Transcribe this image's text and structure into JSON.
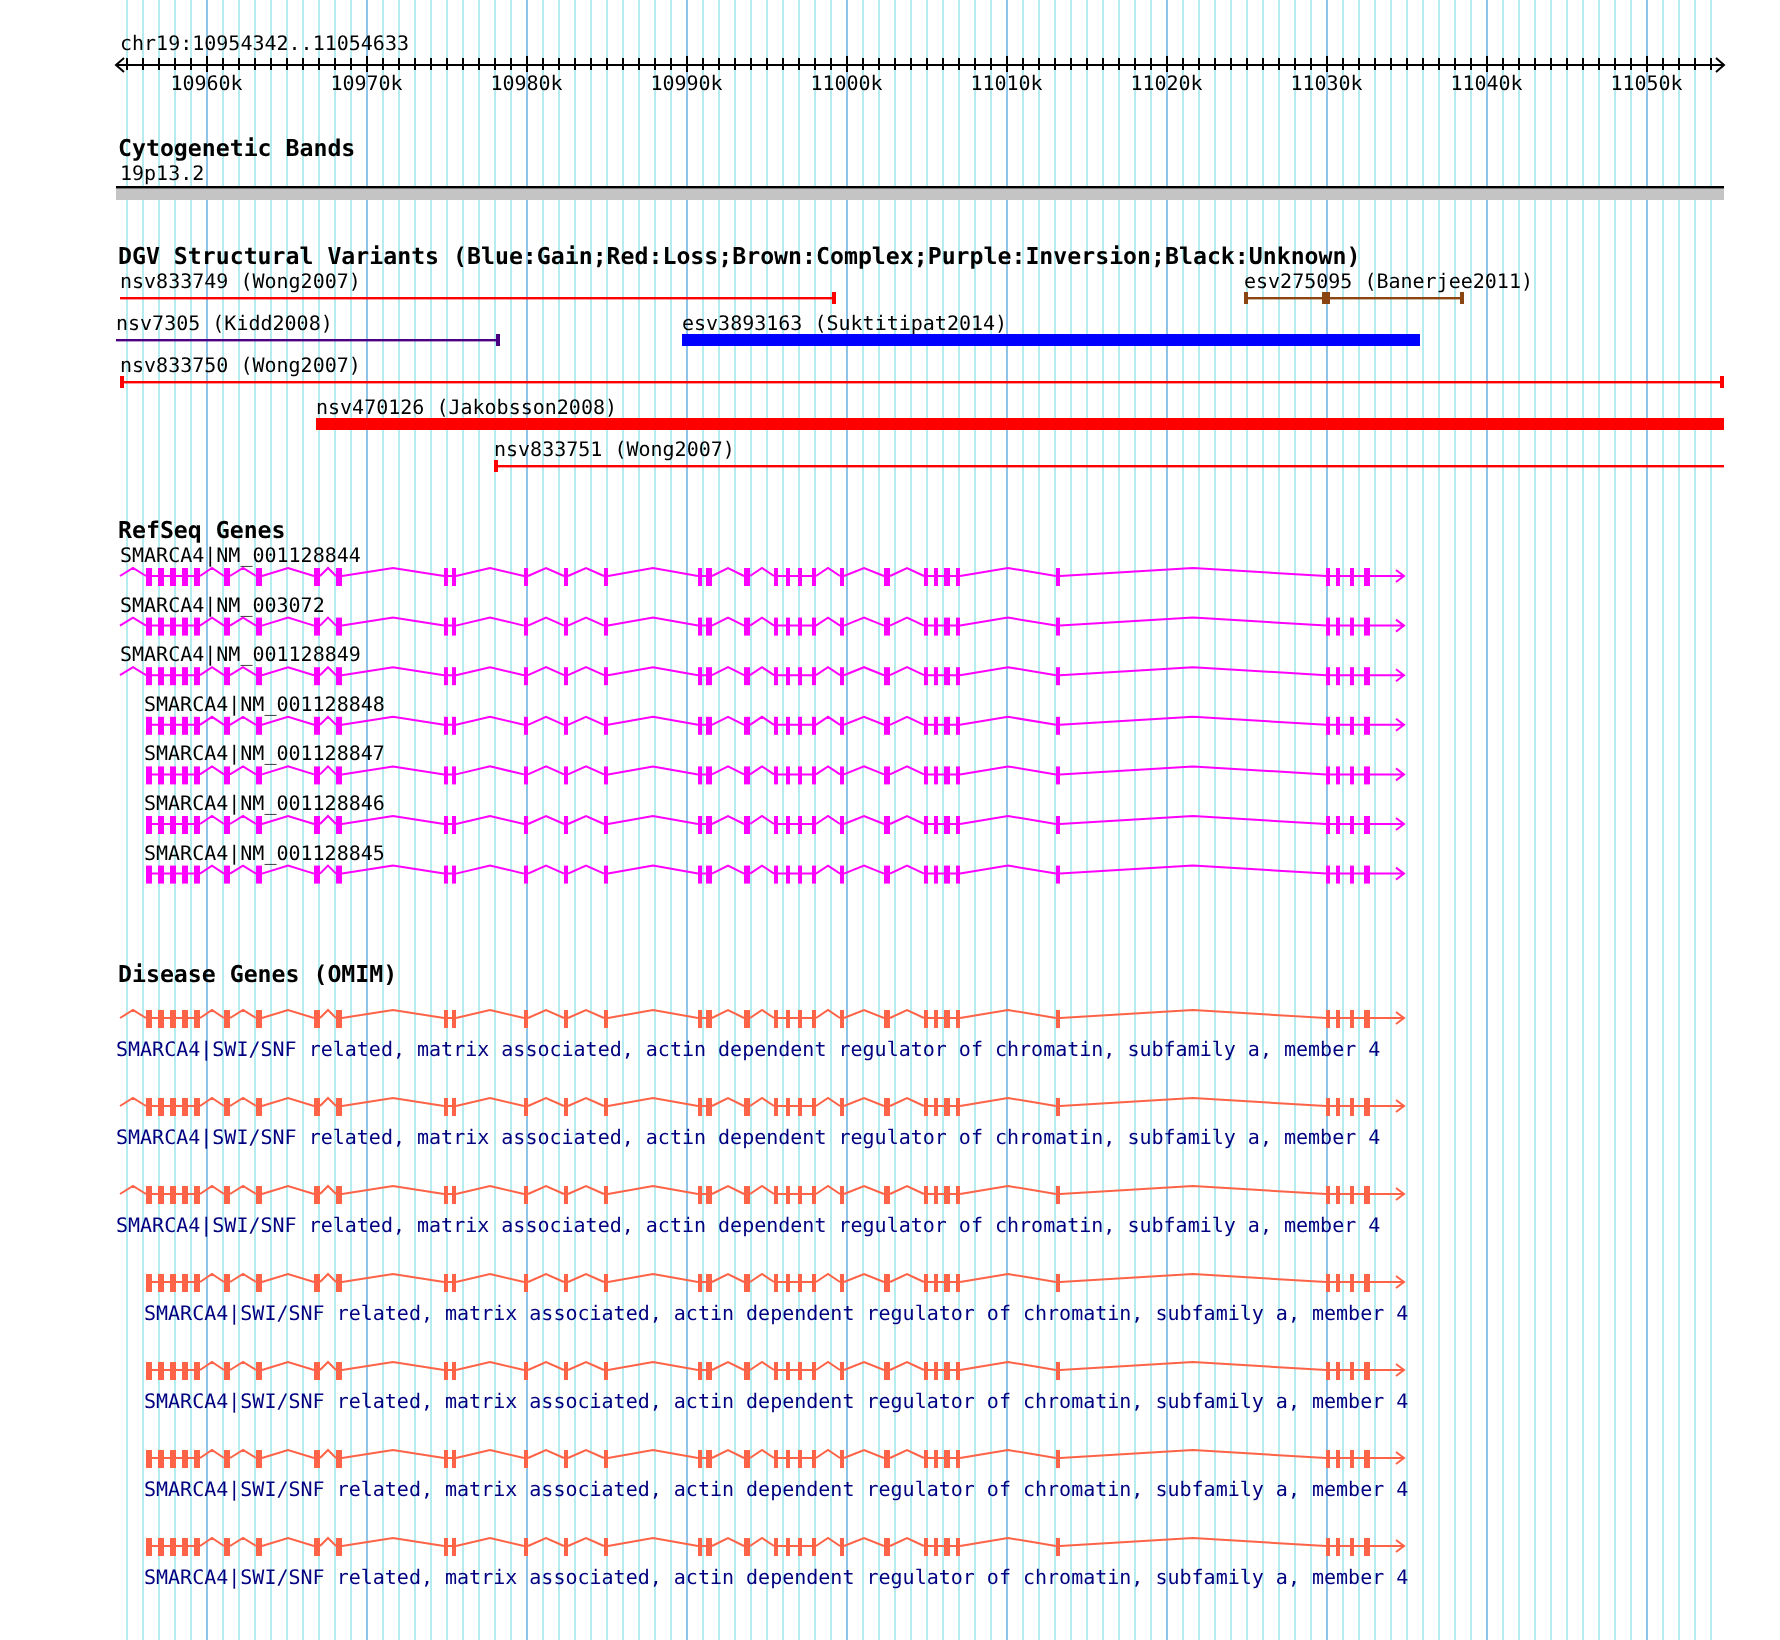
{
  "ruler": {
    "region": "chr19:10954342..11054633",
    "ticks": [
      "10960k",
      "10970k",
      "10980k",
      "10990k",
      "11000k",
      "11010k",
      "11020k",
      "11030k",
      "11040k",
      "11050k"
    ]
  },
  "tracks": [
    {
      "title": "Cytogenetic Bands",
      "kind": "bands",
      "features": [
        {
          "label": "19p13.2"
        }
      ]
    },
    {
      "title": "DGV Structural Variants (Blue:Gain;Red:Loss;Brown:Complex;Purple:Inversion;Black:Unknown)",
      "kind": "variants",
      "features": [
        {
          "label": "nsv833749 (Wong2007)",
          "color": "#ff0000",
          "kind": "thin"
        },
        {
          "label": "esv275095 (Banerjee2011)",
          "color": "#8b4513",
          "kind": "thin"
        },
        {
          "label": "nsv7305 (Kidd2008)",
          "color": "#4b0082",
          "kind": "thin"
        },
        {
          "label": "esv3893163 (Suktitipat2014)",
          "color": "#0000ff",
          "kind": "thick"
        },
        {
          "label": "nsv833750 (Wong2007)",
          "color": "#ff0000",
          "kind": "thin"
        },
        {
          "label": "nsv470126 (Jakobsson2008)",
          "color": "#ff0000",
          "kind": "thick"
        },
        {
          "label": "nsv833751 (Wong2007)",
          "color": "#ff0000",
          "kind": "thin"
        }
      ]
    },
    {
      "title": "RefSeq Genes",
      "kind": "genes",
      "features": [
        {
          "label": "SMARCA4|NM_001128844"
        },
        {
          "label": "SMARCA4|NM_003072"
        },
        {
          "label": "SMARCA4|NM_001128849"
        },
        {
          "label": "SMARCA4|NM_001128848"
        },
        {
          "label": "SMARCA4|NM_001128847"
        },
        {
          "label": "SMARCA4|NM_001128846"
        },
        {
          "label": "SMARCA4|NM_001128845"
        }
      ]
    },
    {
      "title": "Disease Genes (OMIM)",
      "kind": "disease",
      "features": [
        {
          "label": "SMARCA4|SWI/SNF related, matrix associated, actin dependent regulator of chromatin, subfamily a, member 4"
        },
        {
          "label": "SMARCA4|SWI/SNF related, matrix associated, actin dependent regulator of chromatin, subfamily a, member 4"
        },
        {
          "label": "SMARCA4|SWI/SNF related, matrix associated, actin dependent regulator of chromatin, subfamily a, member 4"
        },
        {
          "label": "SMARCA4|SWI/SNF related, matrix associated, actin dependent regulator of chromatin, subfamily a, member 4"
        },
        {
          "label": "SMARCA4|SWI/SNF related, matrix associated, actin dependent regulator of chromatin, subfamily a, member 4"
        },
        {
          "label": "SMARCA4|SWI/SNF related, matrix associated, actin dependent regulator of chromatin, subfamily a, member 4"
        },
        {
          "label": "SMARCA4|SWI/SNF related, matrix associated, actin dependent regulator of chromatin, subfamily a, member 4"
        }
      ]
    }
  ]
}
